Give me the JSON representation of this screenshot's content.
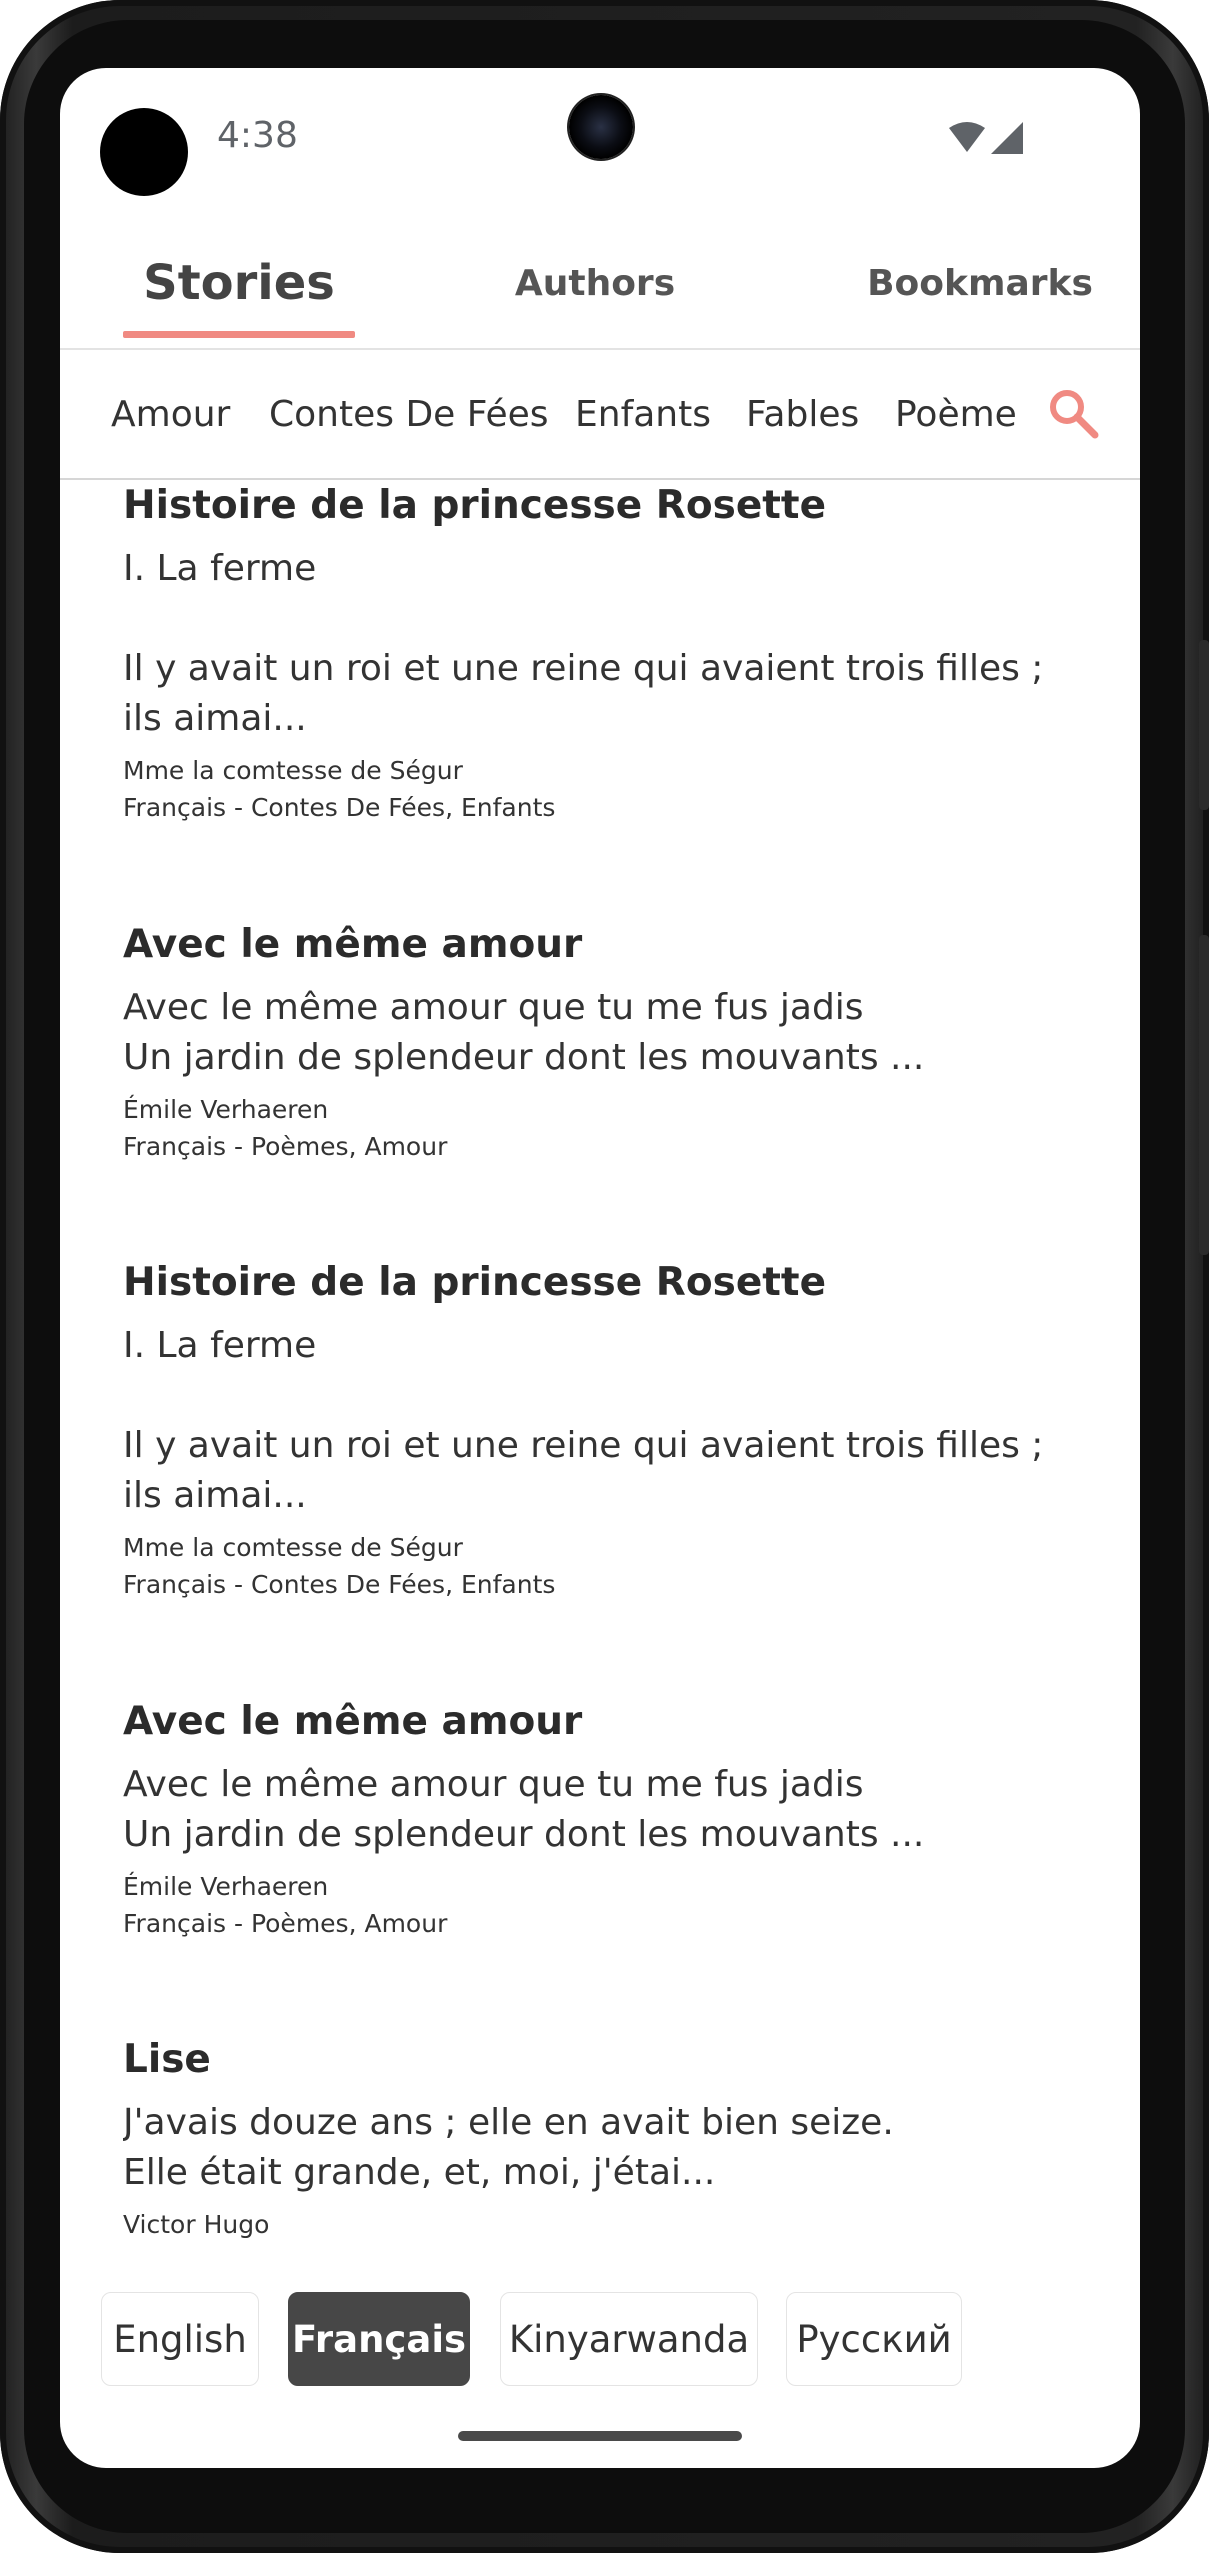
{
  "status_bar": {
    "time": "4:38",
    "icons": [
      "wifi-icon",
      "signal-icon"
    ]
  },
  "tabs": [
    {
      "label": "Stories",
      "active": true
    },
    {
      "label": "Authors",
      "active": false
    },
    {
      "label": "Bookmarks",
      "active": false
    }
  ],
  "categories": [
    "Amour",
    "Contes De Fées",
    "Enfants",
    "Fables",
    "Poème"
  ],
  "search": {
    "icon": "search-icon"
  },
  "stories": [
    {
      "title": "Histoire de la princesse Rosette",
      "excerpt": "I. La ferme\n\nIl y avait un roi et une reine qui avaient trois filles ; ils aimai...",
      "author": "Mme la comtesse de Ségur",
      "meta": "Français - Contes De Fées, Enfants"
    },
    {
      "title": "Avec le même amour",
      "excerpt": "Avec le même amour que tu me fus jadis\nUn jardin de splendeur dont les mouvants ...",
      "author": "Émile Verhaeren",
      "meta": "Français - Poèmes, Amour"
    },
    {
      "title": "Histoire de la princesse Rosette",
      "excerpt": "I. La ferme\n\nIl y avait un roi et une reine qui avaient trois filles ; ils aimai...",
      "author": "Mme la comtesse de Ségur",
      "meta": "Français - Contes De Fées, Enfants"
    },
    {
      "title": "Avec le même amour",
      "excerpt": "Avec le même amour que tu me fus jadis\nUn jardin de splendeur dont les mouvants ...",
      "author": "Émile Verhaeren",
      "meta": "Français - Poèmes, Amour"
    },
    {
      "title": "Lise",
      "excerpt": "J'avais douze ans ; elle en avait bien seize.\nElle était grande, et, moi, j'étai...",
      "author": "Victor Hugo",
      "meta": ""
    }
  ],
  "languages": [
    {
      "label": "English",
      "active": false
    },
    {
      "label": "Français",
      "active": true
    },
    {
      "label": "Kinyarwanda",
      "active": false
    },
    {
      "label": "Русский",
      "active": false
    }
  ],
  "colors": {
    "accent": "#f08a82",
    "active_language_bg": "#474747",
    "text": "#333333"
  }
}
